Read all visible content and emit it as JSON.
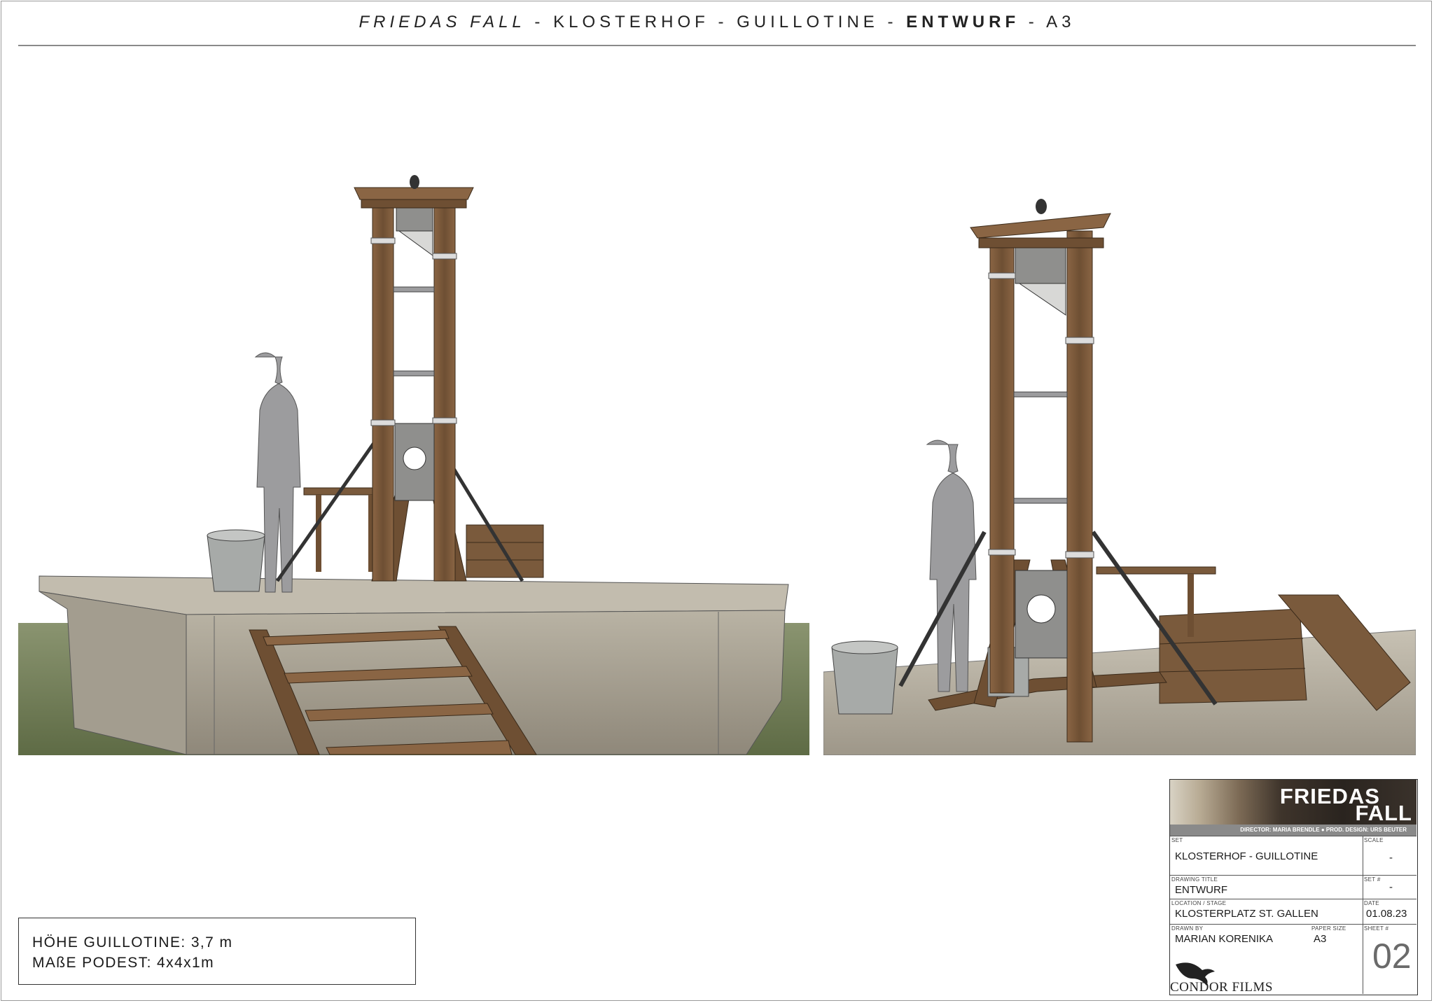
{
  "header": {
    "part1": "FRIEDAS FALL",
    "sep1": " - ",
    "part2": "KLOSTERHOF - GUILLOTINE - ",
    "part3": "ENTWURF",
    "part4": " - A3"
  },
  "info": {
    "line1": "HÖHE GUILLOTINE: 3,7 m",
    "line2": "MAßE PODEST: 4x4x1m"
  },
  "title_block": {
    "logo_line1": "FRIEDAS",
    "logo_line2": "FALL",
    "credits": "DIRECTOR: MARIA BRENDLE   ●   PROD. DESIGN: URS BEUTER",
    "set_label": "SET",
    "set_value": "KLOSTERHOF - GUILLOTINE",
    "scale_label": "SCALE",
    "scale_value": "-",
    "drawing_title_label": "DRAWING TITLE",
    "drawing_title_value": "ENTWURF",
    "set_no_label": "SET #",
    "set_no_value": "-",
    "location_label": "LOCATION / STAGE",
    "location_value": "KLOSTERPLATZ ST. GALLEN",
    "date_label": "DATE",
    "date_value": "01.08.23",
    "drawn_by_label": "DRAWN BY",
    "drawn_by_value": "MARIAN KORENIKA",
    "paper_size_label": "PAPER SIZE",
    "paper_size_value": "A3",
    "sheet_label": "SHEET #",
    "sheet_value": "02",
    "company": "CONDOR FILMS"
  },
  "colors": {
    "wood": "#7a5a3c",
    "wood_dark": "#5a3f28",
    "metal": "#9a9a96",
    "grass": "#6d7a52",
    "silhouette": "#9c9c9e"
  }
}
